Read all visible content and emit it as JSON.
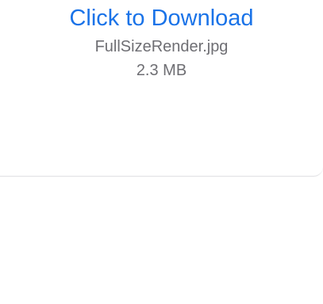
{
  "attachment": {
    "download_label": "Click to Download",
    "file_name": "FullSizeRender.jpg",
    "file_size": "2.3 MB",
    "link_color": "#1a73e8",
    "meta_color": "#6e6e73"
  }
}
